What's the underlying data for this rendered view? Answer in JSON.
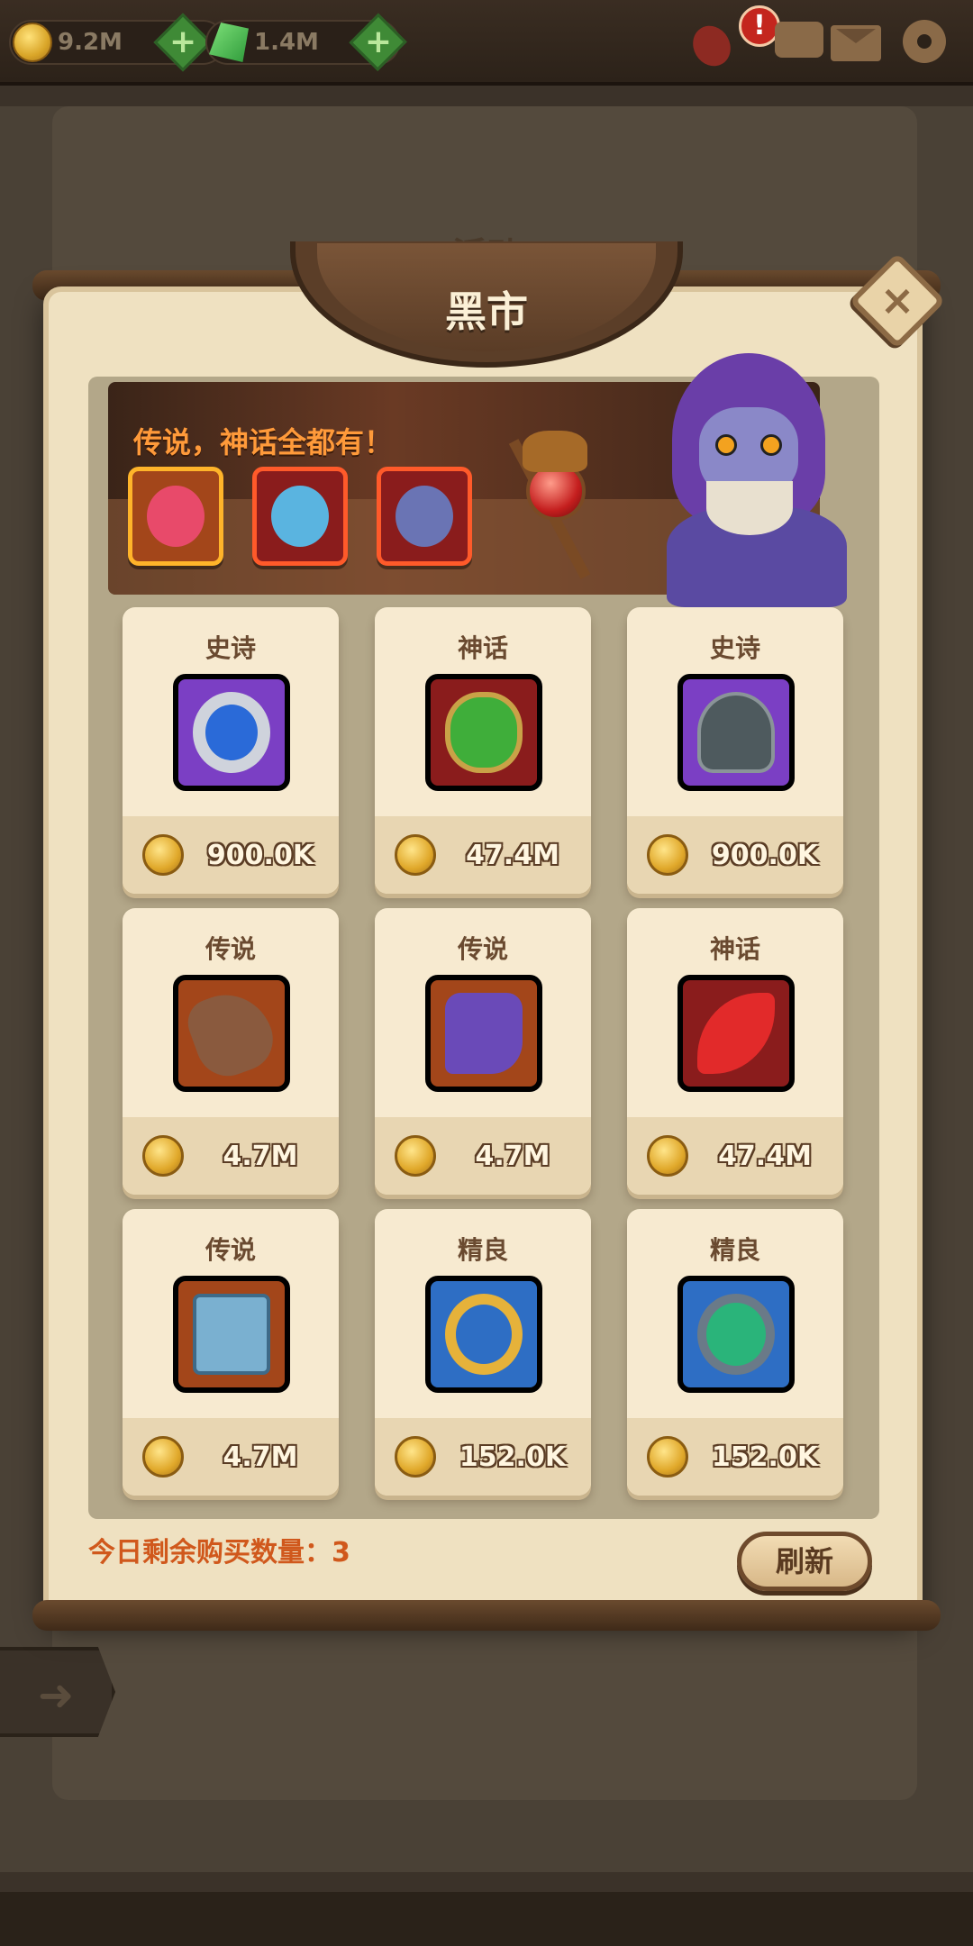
{
  "topbar": {
    "gold": "9.2M",
    "gems": "1.4M",
    "alert_badge": "!"
  },
  "background": {
    "title": "活动"
  },
  "dialog": {
    "title": "黑市",
    "close_label": "×",
    "promo_text": "传说，神话全都有！",
    "remaining_label": "今日剩余购买数量：3",
    "refresh_label": "刷新"
  },
  "items": [
    {
      "rarity": "史诗",
      "price": "900.0K",
      "icon": "ring-icon",
      "tier_color": "#7b3fc4"
    },
    {
      "rarity": "神话",
      "price": "47.4M",
      "icon": "armor-icon",
      "tier_color": "#8a1c1c"
    },
    {
      "rarity": "史诗",
      "price": "900.0K",
      "icon": "helmet-icon",
      "tier_color": "#7b3fc4"
    },
    {
      "rarity": "传说",
      "price": "4.7M",
      "icon": "glove-icon",
      "tier_color": "#a3461a"
    },
    {
      "rarity": "传说",
      "price": "4.7M",
      "icon": "boot-icon",
      "tier_color": "#a3461a"
    },
    {
      "rarity": "神话",
      "price": "47.4M",
      "icon": "blade-icon",
      "tier_color": "#8a1c1c"
    },
    {
      "rarity": "传说",
      "price": "4.7M",
      "icon": "book-icon",
      "tier_color": "#a3461a"
    },
    {
      "rarity": "精良",
      "price": "152.0K",
      "icon": "gold-ring-icon",
      "tier_color": "#2e6ec4"
    },
    {
      "rarity": "精良",
      "price": "152.0K",
      "icon": "amulet-icon",
      "tier_color": "#2e6ec4"
    }
  ]
}
